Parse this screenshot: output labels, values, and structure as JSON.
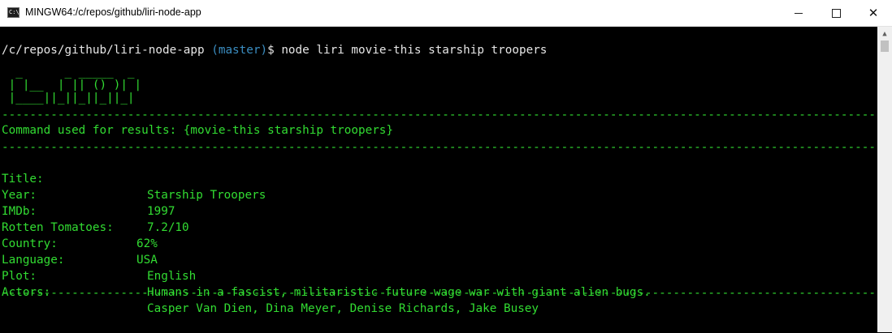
{
  "window": {
    "title": "MINGW64:/c/repos/github/liri-node-app",
    "icon": "terminal-icon",
    "minimize_glyph": "minimize-icon",
    "maximize_glyph": "maximize-icon",
    "close_glyph": "✕"
  },
  "prompt": {
    "path": "/c/repos/github/liri-node-app",
    "branch": "(master)",
    "symbol": "$",
    "command": "node liri movie-this starship troopers"
  },
  "ascii_logo": [
    "  _      _ _____  _",
    " | |__  | || () )| |",
    " |____||_||_||_||_|"
  ],
  "divider": "-----------------------------------------------------------------------------------------------------------------------------------",
  "command_used": "Command used for results: {movie-this starship troopers}",
  "movie": [
    {
      "label": "Title:",
      "value": "Starship Troopers"
    },
    {
      "label": "Year:",
      "value": "1997"
    },
    {
      "label": "IMDb:",
      "value": "7.2/10"
    },
    {
      "label": "Rotten Tomatoes:",
      "value": "62%"
    },
    {
      "label": "Country:",
      "value": "USA"
    },
    {
      "label": "Language:",
      "value": "English"
    },
    {
      "label": "Plot:",
      "value": "Humans in a fascist, militaristic future wage war with giant alien bugs."
    },
    {
      "label": "Actors:",
      "value": "Casper Van Dien, Dina Meyer, Denise Richards, Jake Busey"
    }
  ],
  "colors": {
    "terminal_bg": "#000000",
    "output_green": "#32dc32",
    "prompt_white": "#e6e6e6",
    "branch_cyan": "#3b8ec2"
  }
}
